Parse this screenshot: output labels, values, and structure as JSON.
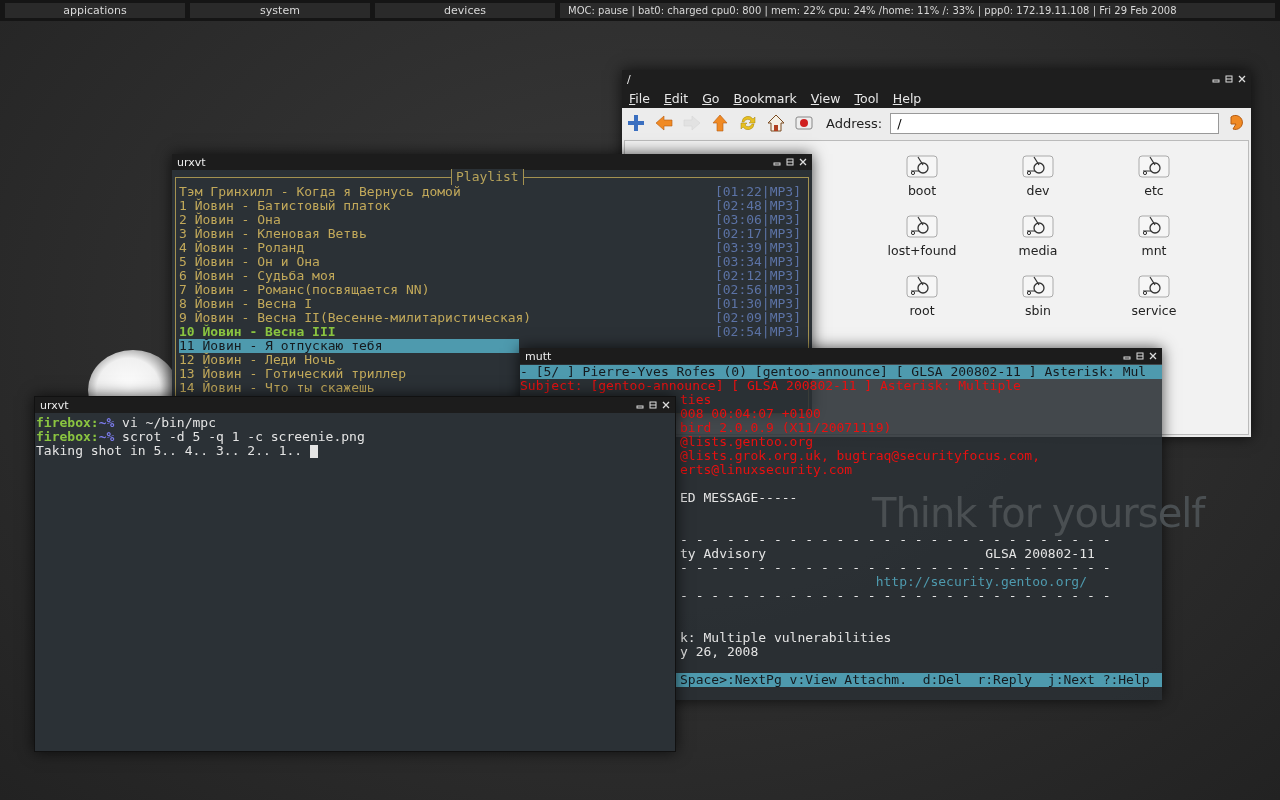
{
  "top_bar": {
    "menus": [
      {
        "label": "appications"
      },
      {
        "label": "system"
      },
      {
        "label": "devices"
      }
    ],
    "status": "MOC: pause | bat0: charged cpu0: 800 | mem: 22% cpu: 24% /home: 11% /: 33% | ppp0: 172.19.11.108 | Fri 29 Feb 2008"
  },
  "wallpaper": {
    "slogan": "Think for yourself"
  },
  "file_manager": {
    "title": "/",
    "menu": [
      "File",
      "Edit",
      "Go",
      "Bookmark",
      "View",
      "Tool",
      "Help"
    ],
    "toolbar": [
      {
        "kind": "new",
        "disabled": false
      },
      {
        "kind": "back",
        "disabled": false
      },
      {
        "kind": "forward",
        "disabled": true
      },
      {
        "kind": "up",
        "disabled": false
      },
      {
        "kind": "refresh",
        "disabled": false
      },
      {
        "kind": "home",
        "disabled": false
      },
      {
        "kind": "trash",
        "disabled": false
      }
    ],
    "address_label": "Address:",
    "address": "/",
    "items": [
      {
        "name": "boot"
      },
      {
        "name": "dev"
      },
      {
        "name": "etc"
      },
      {
        "name": "lost+found"
      },
      {
        "name": "media"
      },
      {
        "name": "mnt"
      },
      {
        "name": "root"
      },
      {
        "name": "sbin"
      },
      {
        "name": "service"
      }
    ]
  },
  "playlist_window": {
    "title": "urxvt",
    "heading": "Playlist",
    "tracks": [
      {
        "title": "Тэм Гринхилл - Когда я Вернусь домой",
        "time": "[01:22|MP3]",
        "playing": false,
        "selected": false
      },
      {
        "title": "1 Йовин - Батистовый платок",
        "time": "[02:48|MP3]",
        "playing": false,
        "selected": false
      },
      {
        "title": "2 Йовин - Она",
        "time": "[03:06|MP3]",
        "playing": false,
        "selected": false
      },
      {
        "title": "3 Йовин - Кленовая Ветвь",
        "time": "[02:17|MP3]",
        "playing": false,
        "selected": false
      },
      {
        "title": "4 Йовин - Роланд",
        "time": "[03:39|MP3]",
        "playing": false,
        "selected": false
      },
      {
        "title": "5 Йовин - Он и Она",
        "time": "[03:34|MP3]",
        "playing": false,
        "selected": false
      },
      {
        "title": "6 Йовин - Судьба моя",
        "time": "[02:12|MP3]",
        "playing": false,
        "selected": false
      },
      {
        "title": "7 Йовин - Романс(посвящается NN)",
        "time": "[02:56|MP3]",
        "playing": false,
        "selected": false
      },
      {
        "title": "8 Йовин - Весна I",
        "time": "[01:30|MP3]",
        "playing": false,
        "selected": false
      },
      {
        "title": "9 Йовин - Весна II(Весенне-милитаристическая)",
        "time": "[02:09|MP3]",
        "playing": false,
        "selected": false
      },
      {
        "title": "10 Йовин - Весна III",
        "time": "[02:54|MP3]",
        "playing": true,
        "selected": false
      },
      {
        "title": "11 Йовин - Я отпускаю тебя",
        "playing": false,
        "selected": true
      },
      {
        "title": "12 Йовин - Леди Ночь",
        "playing": false,
        "selected": false
      },
      {
        "title": "13 Йовин - Готический триллер",
        "playing": false,
        "selected": false
      },
      {
        "title": "14 Йовин - Что ты скажешь",
        "playing": false,
        "selected": false
      }
    ]
  },
  "mutt_window": {
    "title": "mutt",
    "lines": [
      {
        "kind": "bar",
        "clipped": false,
        "text": "- [5/ ] Pierre-Yves Rofes (0) [gentoo-announce] [ GLSA 200802-11 ] Asterisk: Mul"
      },
      {
        "kind": "header",
        "clipped": false,
        "text": "Subject: [gentoo-announce] [ GLSA 200802-11 ] Asterisk: Multiple"
      },
      {
        "kind": "header",
        "clipped": true,
        "text": "ties"
      },
      {
        "kind": "header",
        "clipped": true,
        "text": "008 00:04:07 +0100"
      },
      {
        "kind": "header",
        "clipped": true,
        "text": "bird 2.0.0.9 (X11/20071119)"
      },
      {
        "kind": "header",
        "clipped": true,
        "text": "@lists.gentoo.org"
      },
      {
        "kind": "header",
        "clipped": true,
        "text": "@lists.grok.org.uk, bugtraq@securityfocus.com,"
      },
      {
        "kind": "header",
        "clipped": true,
        "text": "erts@linuxsecurity.com"
      },
      {
        "kind": "blank"
      },
      {
        "kind": "body",
        "clipped": true,
        "text": "ED MESSAGE-----"
      },
      {
        "kind": "blank"
      },
      {
        "kind": "blank"
      },
      {
        "kind": "body",
        "clipped": true,
        "text": "- - - - - - - - - - - - - - - - - - - - - - - - - - - -"
      },
      {
        "kind": "body",
        "clipped": true,
        "text": "ty Advisory                            GLSA 200802-11"
      },
      {
        "kind": "body",
        "clipped": true,
        "text": "- - - - - - - - - - - - - - - - - - - - - - - - - - - -"
      },
      {
        "kind": "link",
        "clipped": true,
        "text": "                         http://security.gentoo.org/"
      },
      {
        "kind": "body",
        "clipped": true,
        "text": "- - - - - - - - - - - - - - - - - - - - - - - - - - - -"
      },
      {
        "kind": "blank"
      },
      {
        "kind": "blank"
      },
      {
        "kind": "body",
        "clipped": true,
        "text": "k: Multiple vulnerabilities"
      },
      {
        "kind": "body",
        "clipped": true,
        "text": "y 26, 2008"
      },
      {
        "kind": "blank"
      },
      {
        "kind": "bar",
        "clipped": true,
        "text": "Space>:NextPg v:View Attachm.  d:Del  r:Reply  j:Next ?:Help"
      }
    ]
  },
  "terminal_window": {
    "title": "urxvt",
    "cursor": true,
    "lines": [
      {
        "kind": "prompt",
        "host": "firebox:",
        "path": "~%",
        "command": "vi ~/bin/mpc"
      },
      {
        "kind": "prompt",
        "host": "firebox:",
        "path": "~%",
        "command": "scrot -d 5 -q 1 -c screenie.png"
      },
      {
        "kind": "output",
        "text": "Taking shot in 5.. 4.. 3.. 2.. 1.."
      }
    ]
  }
}
